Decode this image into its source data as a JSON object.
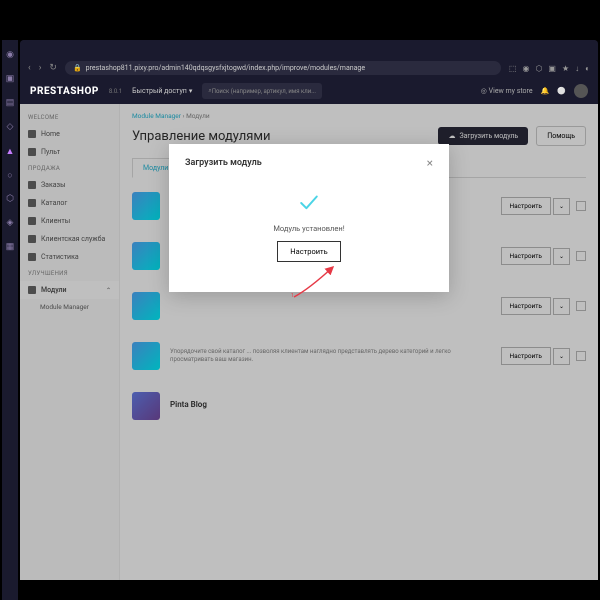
{
  "url": "prestashop811.pixy.pro/admin140qdqsgysfxjtogwd/index.php/improve/modules/manage",
  "brand": "PRESTASHOP",
  "version": "8.0.1",
  "quick_label": "Быстрый доступ",
  "search_placeholder": "Поиск (например, артикул, имя кли...",
  "view_store": "View my store",
  "sidebar": {
    "g1": "WELCOME",
    "home": "Home",
    "pult": "Пульт",
    "g2": "ПРОДАЖА",
    "orders": "Заказы",
    "catalog": "Каталог",
    "clients": "Клиенты",
    "service": "Клиентская служба",
    "stats": "Статистика",
    "g3": "УЛУЧШЕНИЯ",
    "modules": "Модули",
    "mm": "Module Manager"
  },
  "crumb1": "Module Manager",
  "crumb2": "Модули",
  "h1": "Управление модулями",
  "upload_label": "Загрузить модуль",
  "help_label": "Помощь",
  "tab1": "Модули",
  "configure": "Настроить",
  "mod_desc": "Упорядочите свой каталог ... позволяя клиентам наглядно представлять дерево категорий и легко просматривать ваш магазин.",
  "mod_blog": "Pinta Blog",
  "modal": {
    "title": "Загрузить модуль",
    "msg": "Модуль установлен!",
    "btn": "Настроить"
  }
}
